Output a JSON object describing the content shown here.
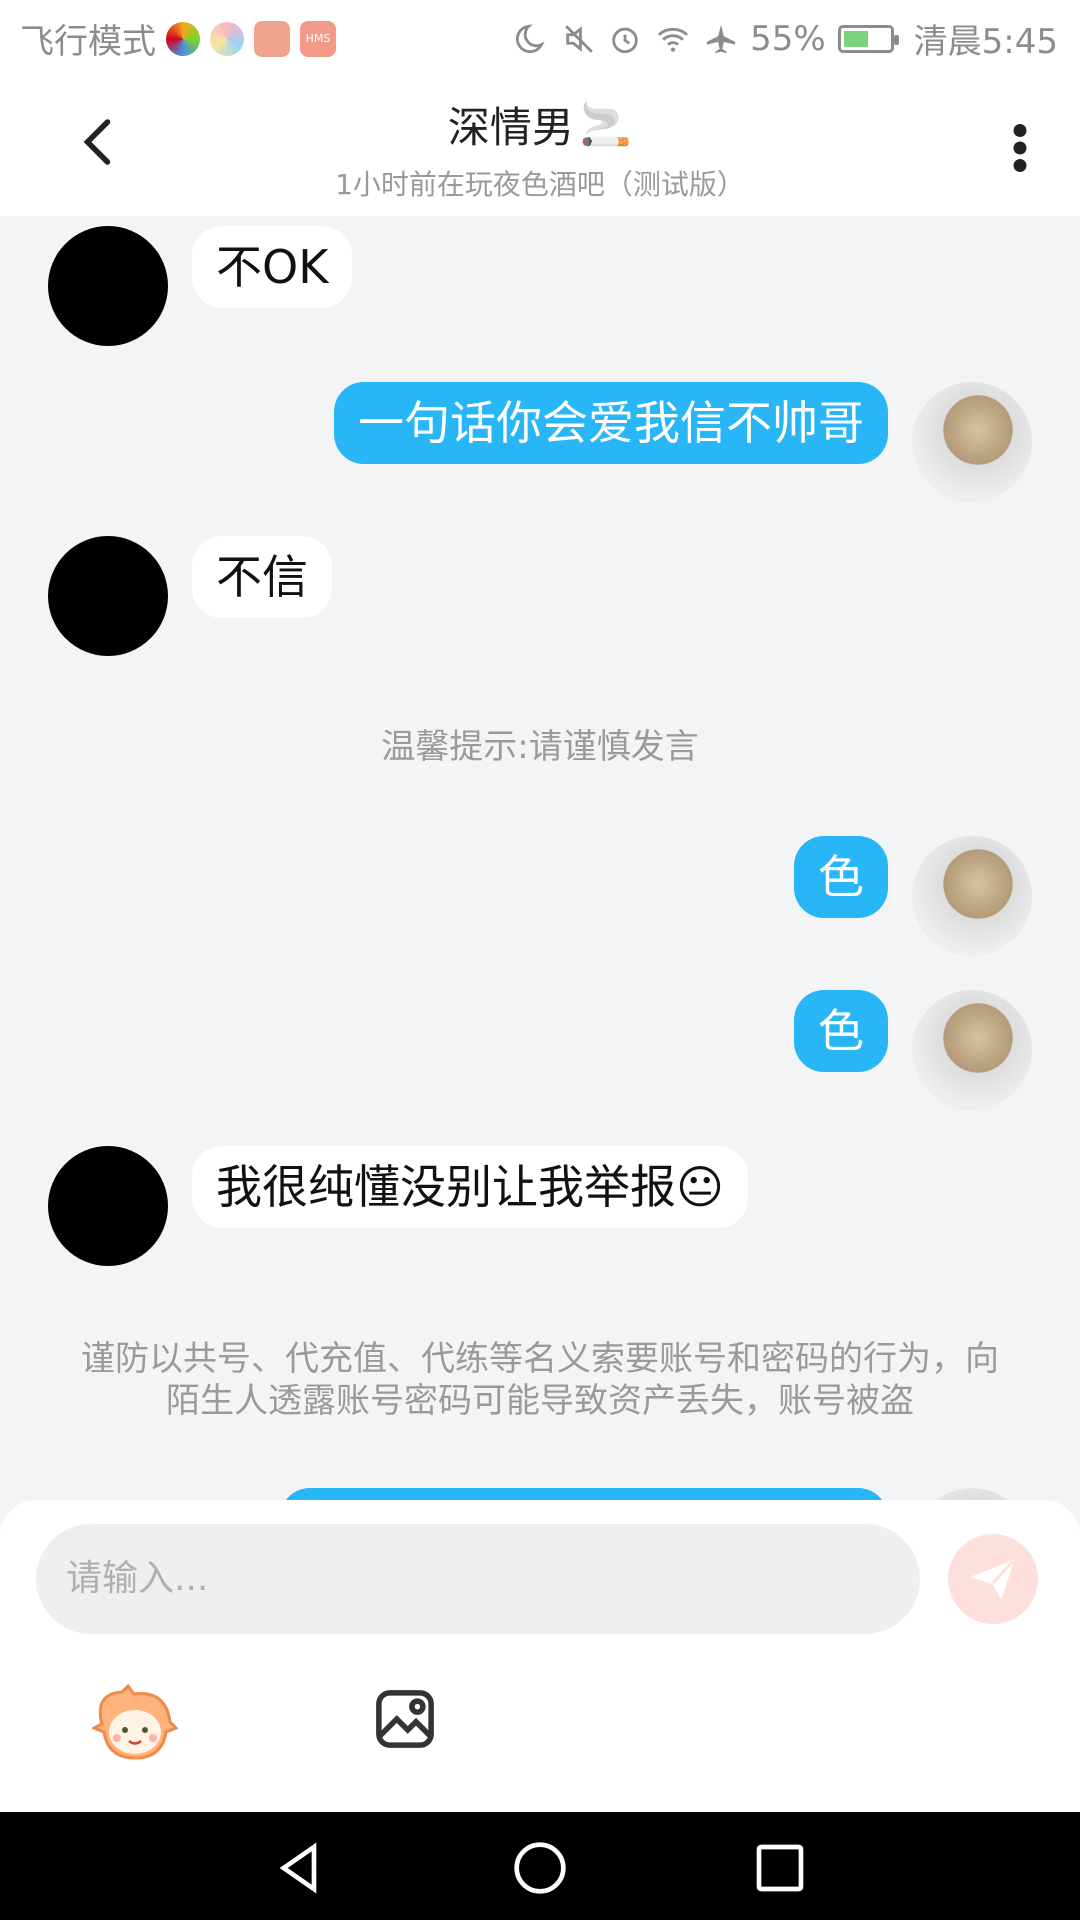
{
  "status_bar": {
    "left_text": "飞行模式",
    "battery_percent": "55%",
    "battery_level": 0.55,
    "time": "清晨5:45",
    "icons": [
      "moon-icon",
      "mute-icon",
      "alarm-icon",
      "wifi-icon",
      "airplane-icon",
      "battery-icon"
    ]
  },
  "header": {
    "title": "深情男",
    "title_emoji": "🚬",
    "subtitle": "1小时前在玩夜色酒吧（测试版）"
  },
  "messages": [
    {
      "side": "left",
      "text": "不OK"
    },
    {
      "side": "right",
      "text": "一句话你会爱我信不帅哥"
    },
    {
      "side": "left",
      "text": "不信"
    },
    {
      "side": "notice",
      "text": "温馨提示:请谨慎发言"
    },
    {
      "side": "right",
      "text": "色"
    },
    {
      "side": "right",
      "text": "色"
    },
    {
      "side": "left",
      "text": "我很纯懂没别让我举报😐"
    },
    {
      "side": "notice",
      "text": "谨防以共号、代充值、代练等名义索要账号和密码的行为，向陌生人透露账号密码可能导致资产丢失，账号被盗"
    }
  ],
  "input": {
    "placeholder": "请输入..."
  },
  "colors": {
    "bubble_right": "#29b6f6",
    "bubble_left": "#ffffff",
    "send_button": "#fde0db"
  }
}
